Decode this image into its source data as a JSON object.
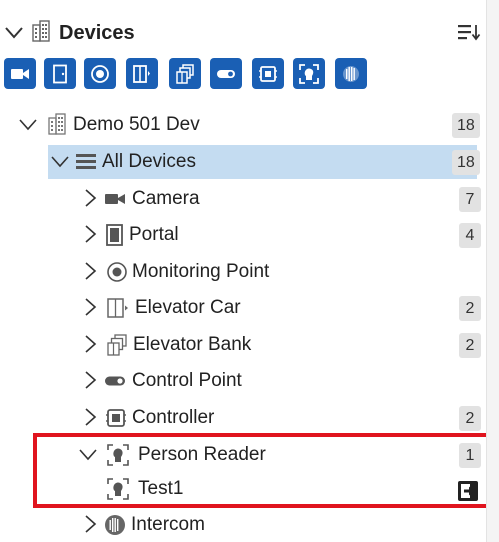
{
  "header": {
    "title": "Devices",
    "icon": "building-icon",
    "collapse_icon": "chevron-down-icon",
    "sort_icon": "sort-list-icon"
  },
  "filters": [
    {
      "name": "camera-filter",
      "icon": "camera-icon"
    },
    {
      "name": "portal-filter",
      "icon": "door-icon"
    },
    {
      "name": "monitoring-point-filter",
      "icon": "target-icon"
    },
    {
      "name": "elevator-car-filter",
      "icon": "elevator-car-icon"
    },
    {
      "name": "elevator-bank-filter",
      "icon": "elevator-bank-icon"
    },
    {
      "name": "control-point-filter",
      "icon": "toggle-icon"
    },
    {
      "name": "controller-filter",
      "icon": "controller-icon"
    },
    {
      "name": "person-reader-filter",
      "icon": "face-reader-icon"
    },
    {
      "name": "intercom-filter",
      "icon": "intercom-icon"
    }
  ],
  "tree": {
    "root": {
      "label": "Demo 501 Dev",
      "count": "18"
    },
    "all_devices": {
      "label": "All Devices",
      "count": "18"
    },
    "items": [
      {
        "label": "Camera",
        "count": "7",
        "icon": "camera-icon"
      },
      {
        "label": "Portal",
        "count": "4",
        "icon": "door-icon"
      },
      {
        "label": "Monitoring Point",
        "count": "",
        "icon": "target-icon"
      },
      {
        "label": "Elevator Car",
        "count": "2",
        "icon": "elevator-car-icon"
      },
      {
        "label": "Elevator Bank",
        "count": "2",
        "icon": "elevator-bank-icon"
      },
      {
        "label": "Control Point",
        "count": "",
        "icon": "toggle-icon"
      },
      {
        "label": "Controller",
        "count": "2",
        "icon": "controller-icon"
      },
      {
        "label": "Person Reader",
        "count": "1",
        "icon": "face-reader-icon"
      },
      {
        "label": "Intercom",
        "count": "",
        "icon": "intercom-icon"
      }
    ],
    "person_reader_child": {
      "label": "Test1",
      "action_icon": "sign-in-icon"
    }
  },
  "colors": {
    "accent": "#1a5fb4",
    "selected_row": "#c4dcf1",
    "highlight_border": "#e0141e",
    "badge_bg": "#e2e2e2"
  }
}
